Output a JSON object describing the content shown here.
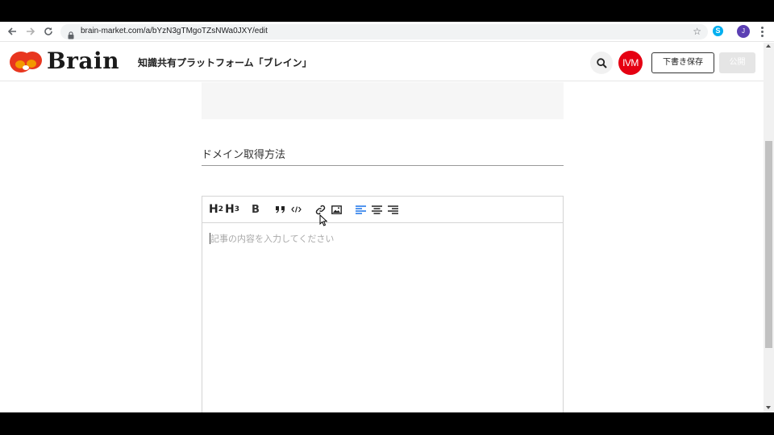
{
  "browser": {
    "url": "brain-market.com/a/bYzN3gTMgoTZsNWa0JXY/edit",
    "extension_label": "S",
    "profile_initial": "J",
    "icons": [
      "back-arrow-icon",
      "forward-arrow-icon",
      "reload-icon",
      "lock-icon",
      "star-icon",
      "menu-kebab-icon"
    ]
  },
  "header": {
    "logo_text": "Brain",
    "tagline": "知識共有プラットフォーム「ブレイン」",
    "avatar_text": "IVM",
    "draft_label": "下書き保存",
    "publish_label": "公開",
    "colors": {
      "logo_red": "#e8361f",
      "logo_orange": "#f39800",
      "avatar": "#e50012"
    }
  },
  "article": {
    "title": "ドメイン取得方法",
    "body_placeholder": "記事の内容を入力してください"
  },
  "toolbar": {
    "h2_label": "H",
    "h2_sub": "2",
    "h3_label": "H",
    "h3_sub": "3",
    "bold_label": "B",
    "quote_label": "99",
    "active_color": "#1a73e8",
    "icons": [
      "quote-icon",
      "code-icon",
      "link-icon",
      "image-icon",
      "align-left-icon",
      "align-center-icon",
      "align-right-icon"
    ]
  }
}
